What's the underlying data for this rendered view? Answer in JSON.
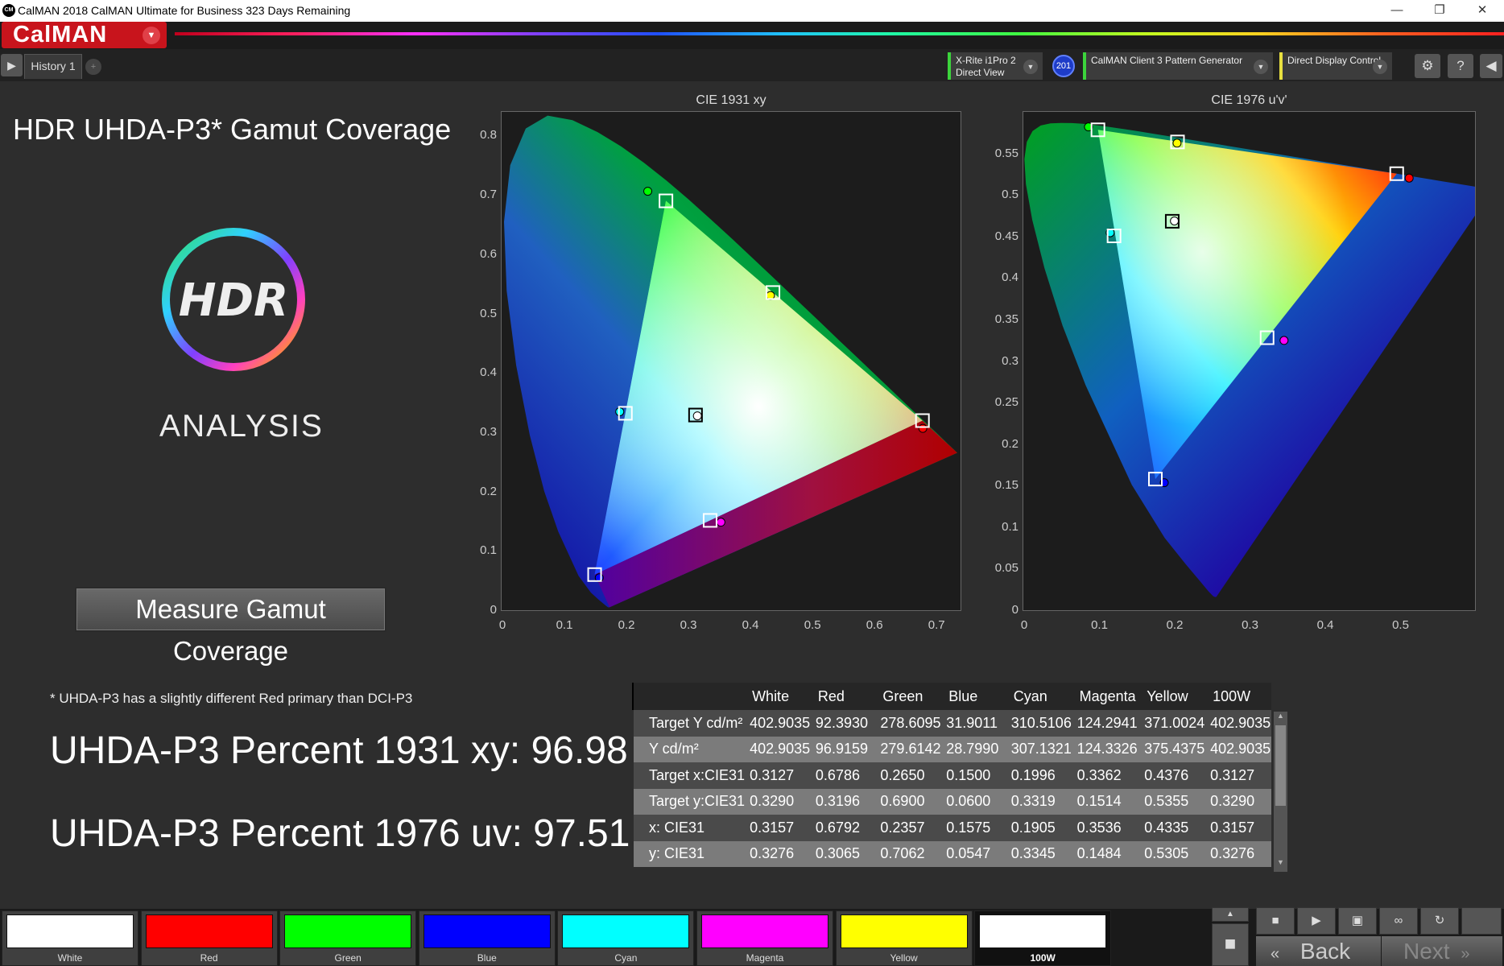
{
  "window": {
    "title": "CalMAN 2018 CalMAN Ultimate for Business 323 Days Remaining",
    "app_icon": "CM"
  },
  "brand": {
    "name": "CalMAN"
  },
  "tabs": [
    {
      "label": "History 1"
    }
  ],
  "devices": {
    "meter": {
      "line1": "X-Rite i1Pro 2",
      "line2": "Direct View",
      "badge": "201"
    },
    "source": {
      "label": "CalMAN Client 3 Pattern Generator"
    },
    "display": {
      "label": "Direct Display Control"
    }
  },
  "main": {
    "title": "HDR UHDA-P3* Gamut Coverage",
    "logo_text": "HDR",
    "analysis_text": "ANALYSIS",
    "measure_button": "Measure Gamut Coverage",
    "footnote": "* UHDA-P3 has a slightly different Red primary than DCI-P3",
    "result_1931": "UHDA-P3 Percent 1931 xy: 96.98",
    "result_1976": "UHDA-P3 Percent 1976 uv: 97.51"
  },
  "chart_data": [
    {
      "type": "scatter",
      "title": "CIE 1931 xy",
      "xlim": [
        0,
        0.74
      ],
      "ylim": [
        0,
        0.84
      ],
      "xticks": [
        "0",
        "0.1",
        "0.2",
        "0.3",
        "0.4",
        "0.5",
        "0.6",
        "0.7"
      ],
      "yticks": [
        "0",
        "0.1",
        "0.2",
        "0.3",
        "0.4",
        "0.5",
        "0.6",
        "0.7",
        "0.8"
      ],
      "series": [
        {
          "name": "Target",
          "marker": "square",
          "points": [
            {
              "label": "White",
              "x": 0.3127,
              "y": 0.329
            },
            {
              "label": "Red",
              "x": 0.6786,
              "y": 0.3196
            },
            {
              "label": "Green",
              "x": 0.265,
              "y": 0.69
            },
            {
              "label": "Blue",
              "x": 0.15,
              "y": 0.06
            },
            {
              "label": "Cyan",
              "x": 0.1996,
              "y": 0.3319
            },
            {
              "label": "Magenta",
              "x": 0.3362,
              "y": 0.1514
            },
            {
              "label": "Yellow",
              "x": 0.4376,
              "y": 0.5355
            }
          ]
        },
        {
          "name": "Measured",
          "marker": "circle",
          "points": [
            {
              "label": "White",
              "x": 0.3157,
              "y": 0.3276
            },
            {
              "label": "Red",
              "x": 0.6792,
              "y": 0.3065
            },
            {
              "label": "Green",
              "x": 0.2357,
              "y": 0.7062
            },
            {
              "label": "Blue",
              "x": 0.1575,
              "y": 0.0547
            },
            {
              "label": "Cyan",
              "x": 0.1905,
              "y": 0.3345
            },
            {
              "label": "Magenta",
              "x": 0.3536,
              "y": 0.1484
            },
            {
              "label": "Yellow",
              "x": 0.4335,
              "y": 0.5305
            }
          ]
        }
      ]
    },
    {
      "type": "scatter",
      "title": "CIE 1976 u'v'",
      "xlim": [
        0,
        0.6
      ],
      "ylim": [
        0,
        0.6
      ],
      "xticks": [
        "0",
        "0.1",
        "0.2",
        "0.3",
        "0.4",
        "0.5"
      ],
      "yticks": [
        "0",
        "0.05",
        "0.1",
        "0.15",
        "0.2",
        "0.25",
        "0.3",
        "0.35",
        "0.4",
        "0.45",
        "0.5",
        "0.55"
      ],
      "series": [
        {
          "name": "Target",
          "marker": "square",
          "points": [
            {
              "label": "White",
              "x": 0.1978,
              "y": 0.4683
            },
            {
              "label": "Red",
              "x": 0.496,
              "y": 0.5256
            },
            {
              "label": "Green",
              "x": 0.0991,
              "y": 0.5784
            },
            {
              "label": "Blue",
              "x": 0.1754,
              "y": 0.1579
            },
            {
              "label": "Cyan",
              "x": 0.1205,
              "y": 0.4507
            },
            {
              "label": "Magenta",
              "x": 0.3238,
              "y": 0.3281
            },
            {
              "label": "Yellow",
              "x": 0.2048,
              "y": 0.5638
            }
          ]
        },
        {
          "name": "Measured",
          "marker": "circle",
          "points": [
            {
              "label": "White",
              "x": 0.2007,
              "y": 0.4687
            },
            {
              "label": "Red",
              "x": 0.5125,
              "y": 0.5203
            },
            {
              "label": "Green",
              "x": 0.0865,
              "y": 0.5819
            },
            {
              "label": "Blue",
              "x": 0.1872,
              "y": 0.1535
            },
            {
              "label": "Cyan",
              "x": 0.1153,
              "y": 0.4545
            },
            {
              "label": "Magenta",
              "x": 0.3463,
              "y": 0.3248
            },
            {
              "label": "Yellow",
              "x": 0.2042,
              "y": 0.5624
            }
          ]
        }
      ]
    },
    {
      "type": "table",
      "columns": [
        "",
        "White",
        "Red",
        "Green",
        "Blue",
        "Cyan",
        "Magenta",
        "Yellow",
        "100W"
      ],
      "rows": [
        {
          "label": "Target Y cd/m²",
          "values": [
            "402.9035",
            "92.3930",
            "278.6095",
            "31.9011",
            "310.5106",
            "124.2941",
            "371.0024",
            "402.9035"
          ]
        },
        {
          "label": "Y cd/m²",
          "values": [
            "402.9035",
            "96.9159",
            "279.6142",
            "28.7990",
            "307.1321",
            "124.3326",
            "375.4375",
            "402.9035"
          ]
        },
        {
          "label": "Target x:CIE31",
          "values": [
            "0.3127",
            "0.6786",
            "0.2650",
            "0.1500",
            "0.1996",
            "0.3362",
            "0.4376",
            "0.3127"
          ]
        },
        {
          "label": "Target y:CIE31",
          "values": [
            "0.3290",
            "0.3196",
            "0.6900",
            "0.0600",
            "0.3319",
            "0.1514",
            "0.5355",
            "0.3290"
          ]
        },
        {
          "label": "x: CIE31",
          "values": [
            "0.3157",
            "0.6792",
            "0.2357",
            "0.1575",
            "0.1905",
            "0.3536",
            "0.4335",
            "0.3157"
          ]
        },
        {
          "label": "y: CIE31",
          "values": [
            "0.3276",
            "0.3065",
            "0.7062",
            "0.0547",
            "0.3345",
            "0.1484",
            "0.5305",
            "0.3276"
          ]
        }
      ]
    }
  ],
  "swatches": [
    {
      "label": "White",
      "color": "#ffffff"
    },
    {
      "label": "Red",
      "color": "#ff0000"
    },
    {
      "label": "Green",
      "color": "#00ff00"
    },
    {
      "label": "Blue",
      "color": "#0000ff"
    },
    {
      "label": "Cyan",
      "color": "#00ffff"
    },
    {
      "label": "Magenta",
      "color": "#ff00ff"
    },
    {
      "label": "Yellow",
      "color": "#ffff00"
    },
    {
      "label": "100W",
      "color": "#ffffff",
      "selected": true
    }
  ],
  "footer": {
    "back": "Back",
    "next": "Next"
  },
  "icons": [
    "gear-icon",
    "help-icon",
    "collapse-icon",
    "play-icon",
    "stop-icon",
    "save-icon",
    "loop-icon",
    "refresh-icon"
  ]
}
